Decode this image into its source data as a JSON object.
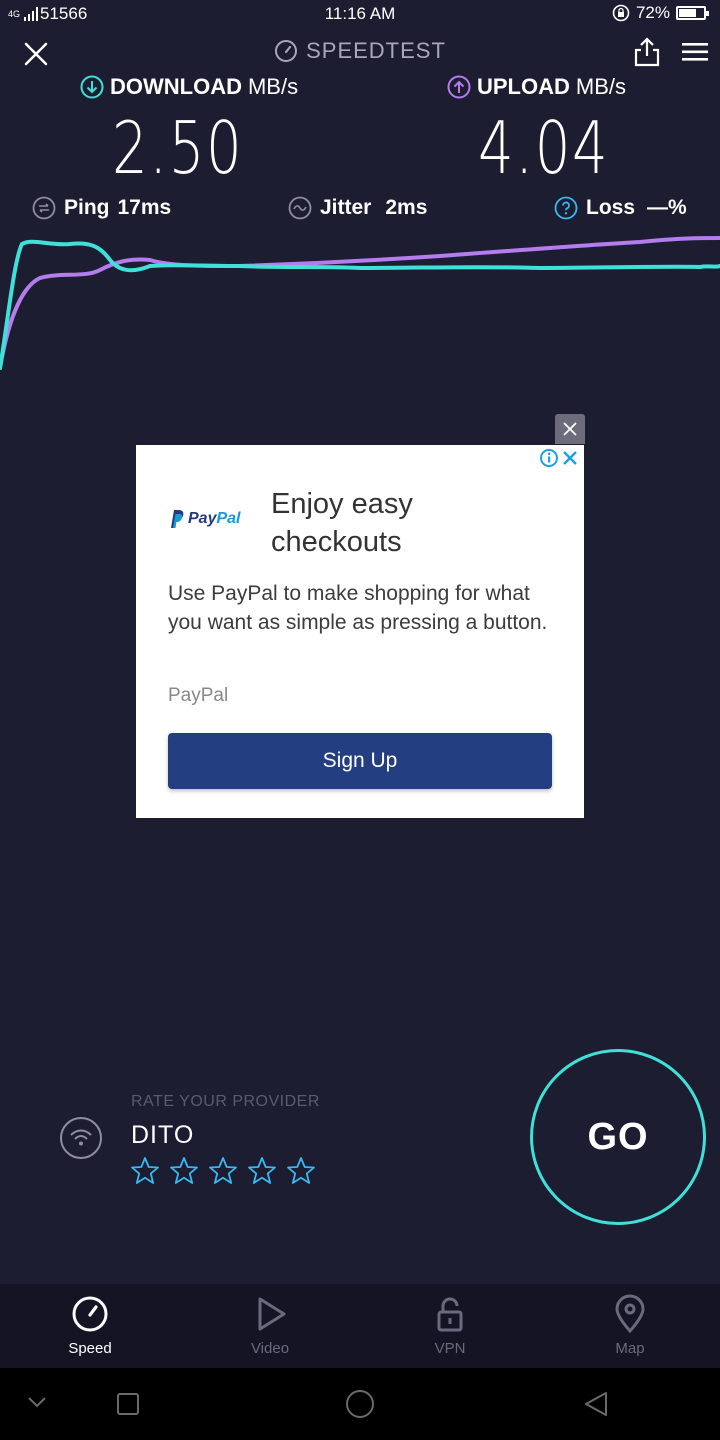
{
  "status_bar": {
    "network": "4G",
    "carrier": "51566",
    "time": "11:16 AM",
    "battery": "72%",
    "battery_level": 0.72
  },
  "header": {
    "brand": "SPEEDTEST"
  },
  "download": {
    "label": "DOWNLOAD",
    "unit": "MB/s",
    "value": "2.50",
    "color": "#3ee0d8"
  },
  "upload": {
    "label": "UPLOAD",
    "unit": "MB/s",
    "value": "4.04",
    "color": "#b57cf0"
  },
  "stats": {
    "ping_label": "Ping",
    "ping_value": "17ms",
    "jitter_label": "Jitter",
    "jitter_value": "2ms",
    "loss_label": "Loss",
    "loss_value": "—%"
  },
  "ad": {
    "logo_text_1": "Pay",
    "logo_text_2": "Pal",
    "title": "Enjoy easy checkouts",
    "body": "Use PayPal to make shopping for what you want as simple as pressing a button.",
    "source": "PayPal",
    "cta": "Sign Up"
  },
  "provider": {
    "caption": "RATE YOUR PROVIDER",
    "name": "DITO",
    "rating_max": 5,
    "rating": 0
  },
  "go_button": "GO",
  "tabs": [
    {
      "label": "Speed",
      "icon": "speedometer-icon",
      "active": true
    },
    {
      "label": "Video",
      "icon": "play-icon",
      "active": false
    },
    {
      "label": "VPN",
      "icon": "lock-icon",
      "active": false
    },
    {
      "label": "Map",
      "icon": "map-pin-icon",
      "active": false
    }
  ],
  "colors": {
    "background": "#1d1d31",
    "accent_cyan": "#3ee0d8",
    "accent_purple": "#b57cf0",
    "ad_button": "#243e82"
  }
}
